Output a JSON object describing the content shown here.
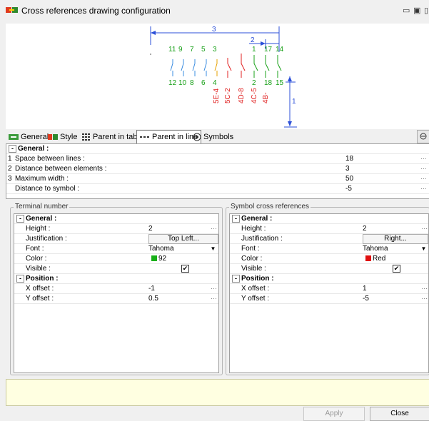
{
  "window": {
    "title": "Cross references drawing configuration",
    "controls": [
      "minimize-icon",
      "maximize-icon",
      "close-icon"
    ]
  },
  "preview": {
    "dimension_labels": [
      "3",
      "2",
      "1"
    ],
    "top_numbers": [
      "11",
      "9",
      "7",
      "5",
      "3",
      "1",
      "17",
      "14"
    ],
    "bottom_numbers": [
      "12",
      "10",
      "8",
      "6",
      "4",
      "2",
      "18",
      "15"
    ],
    "rotated_labels": [
      "5E-4",
      "5C-2",
      "4D-8",
      "4C-5",
      "4B-"
    ],
    "colors": {
      "dim": "#2b4fd8",
      "green": "#18a018",
      "blue": "#3a8ce0",
      "orange": "#e6a000",
      "red": "#e02020"
    }
  },
  "tabs": [
    {
      "label": "General",
      "icon": "general-icon"
    },
    {
      "label": "Style",
      "icon": "style-icon"
    },
    {
      "label": "Parent in table",
      "icon": "table-icon"
    },
    {
      "label": "Parent in line",
      "icon": "line-icon",
      "active": true
    },
    {
      "label": "Symbols",
      "icon": "symbols-icon"
    }
  ],
  "main_grid": {
    "group": "General :",
    "rows": [
      {
        "num": "1",
        "label": "Space between lines :",
        "value": "18"
      },
      {
        "num": "2",
        "label": "Distance between elements :",
        "value": "3"
      },
      {
        "num": "3",
        "label": "Maximum width :",
        "value": "50"
      },
      {
        "num": "",
        "label": "Distance to symbol :",
        "value": "-5"
      }
    ]
  },
  "terminal": {
    "legend": "Terminal number",
    "general": "General :",
    "height_label": "Height :",
    "height": "2",
    "justification_label": "Justification :",
    "justification": "Top Left...",
    "font_label": "Font :",
    "font": "Tahoma",
    "color_label": "Color :",
    "color": "92",
    "color_hex": "#18b018",
    "visible_label": "Visible :",
    "position": "Position :",
    "x_label": "X offset :",
    "x": "-1",
    "y_label": "Y offset :",
    "y": "0.5"
  },
  "symbol": {
    "legend": "Symbol cross references",
    "general": "General :",
    "height_label": "Height :",
    "height": "2",
    "justification_label": "Justification :",
    "justification": "Right...",
    "font_label": "Font :",
    "font": "Tahoma",
    "color_label": "Color :",
    "color": "Red",
    "color_hex": "#e01010",
    "visible_label": "Visible :",
    "position": "Position :",
    "x_label": "X offset :",
    "x": "1",
    "y_label": "Y offset :",
    "y": "-5"
  },
  "footer": {
    "apply": "Apply",
    "close": "Close"
  },
  "glyphs": {
    "minus": "-",
    "check": "✔",
    "dots": "···",
    "arrow": "▼",
    "win_min": "▭",
    "win_max": "▣",
    "win_close": "▯"
  }
}
